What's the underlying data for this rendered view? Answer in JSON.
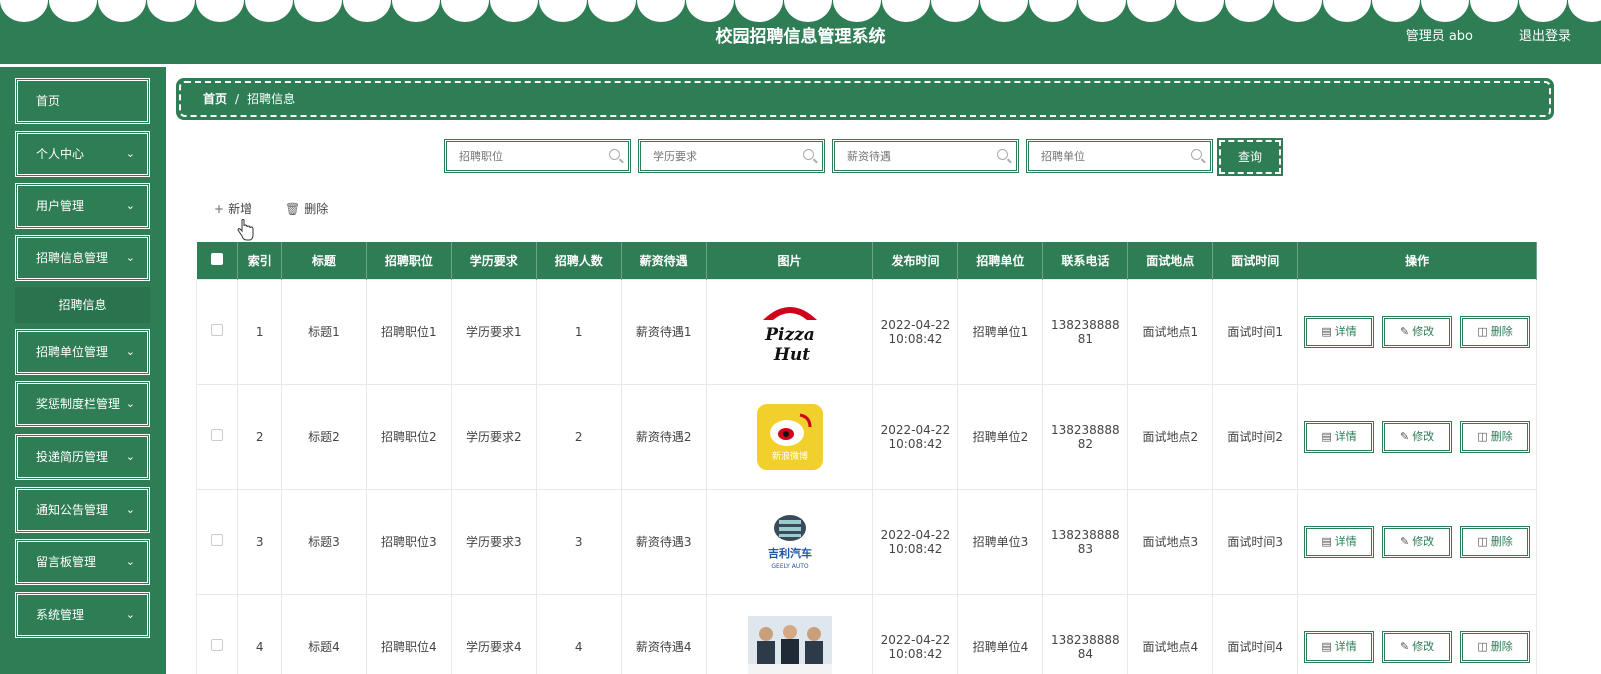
{
  "header": {
    "title": "校园招聘信息管理系统",
    "user": "管理员 abo",
    "logout": "退出登录"
  },
  "sidebar": {
    "items": [
      {
        "label": "首页",
        "icon": "chevron-down-icon",
        "has_chevron": false
      },
      {
        "label": "个人中心",
        "has_chevron": true
      },
      {
        "label": "用户管理",
        "has_chevron": true
      },
      {
        "label": "招聘信息管理",
        "has_chevron": true
      },
      {
        "label": "招聘单位管理",
        "has_chevron": true
      },
      {
        "label": "奖惩制度栏管理",
        "has_chevron": true
      },
      {
        "label": "投递简历管理",
        "has_chevron": true
      },
      {
        "label": "通知公告管理",
        "has_chevron": true
      },
      {
        "label": "留言板管理",
        "has_chevron": true
      },
      {
        "label": "系统管理",
        "has_chevron": true
      }
    ],
    "sub_item": "招聘信息"
  },
  "breadcrumb": {
    "home": "首页",
    "separator": "/",
    "current": "招聘信息"
  },
  "search": {
    "fields": [
      {
        "placeholder": "招聘职位"
      },
      {
        "placeholder": "学历要求"
      },
      {
        "placeholder": "薪资待遇"
      },
      {
        "placeholder": "招聘单位"
      }
    ],
    "button": "查询"
  },
  "toolbar": {
    "add": "新增",
    "delete": "删除"
  },
  "table": {
    "columns": [
      "索引",
      "标题",
      "招聘职位",
      "学历要求",
      "招聘人数",
      "薪资待遇",
      "图片",
      "发布时间",
      "招聘单位",
      "联系电话",
      "面试地点",
      "面试时间",
      "操作"
    ],
    "rows": [
      {
        "index": "1",
        "title": "标题1",
        "position": "招聘职位1",
        "education": "学历要求1",
        "count": "1",
        "salary": "薪资待遇1",
        "image": "pizza-hut-logo",
        "date": "2022-04-22",
        "time": "10:08:42",
        "company": "招聘单位1",
        "phone_a": "138238888",
        "phone_b": "81",
        "location": "面试地点1",
        "interview_time": "面试时间1"
      },
      {
        "index": "2",
        "title": "标题2",
        "position": "招聘职位2",
        "education": "学历要求2",
        "count": "2",
        "salary": "薪资待遇2",
        "image": "weibo-logo",
        "date": "2022-04-22",
        "time": "10:08:42",
        "company": "招聘单位2",
        "phone_a": "138238888",
        "phone_b": "82",
        "location": "面试地点2",
        "interview_time": "面试时间2"
      },
      {
        "index": "3",
        "title": "标题3",
        "position": "招聘职位3",
        "education": "学历要求3",
        "count": "3",
        "salary": "薪资待遇3",
        "image": "geely-logo",
        "date": "2022-04-22",
        "time": "10:08:42",
        "company": "招聘单位3",
        "phone_a": "138238888",
        "phone_b": "83",
        "location": "面试地点3",
        "interview_time": "面试时间3"
      },
      {
        "index": "4",
        "title": "标题4",
        "position": "招聘职位4",
        "education": "学历要求4",
        "count": "4",
        "salary": "薪资待遇4",
        "image": "meeting-photo",
        "date": "2022-04-22",
        "time": "10:08:42",
        "company": "招聘单位4",
        "phone_a": "138238888",
        "phone_b": "84",
        "location": "面试地点4",
        "interview_time": "面试时间4"
      }
    ],
    "actions": {
      "detail": "详情",
      "edit": "修改",
      "delete": "删除"
    }
  },
  "logos": {
    "pizza_a": "Pizza",
    "pizza_b": "Hut",
    "weibo": "新浪微博",
    "geely": "吉利汽车",
    "geely_en": "GEELY AUTO"
  },
  "colors": {
    "primary": "#2e7d55",
    "white": "#ffffff"
  }
}
